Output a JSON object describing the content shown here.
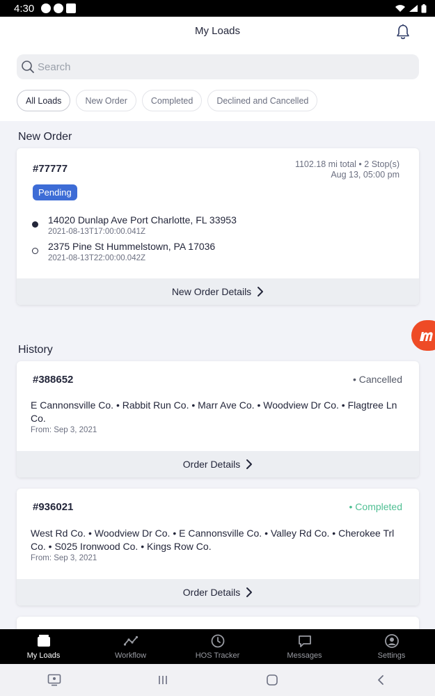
{
  "status_bar": {
    "time": "4:30"
  },
  "header": {
    "title": "My Loads"
  },
  "search": {
    "placeholder": "Search"
  },
  "filters": [
    {
      "label": "All Loads",
      "active": true
    },
    {
      "label": "New Order",
      "active": false
    },
    {
      "label": "Completed",
      "active": false
    },
    {
      "label": "Declined and Cancelled",
      "active": false
    }
  ],
  "new_order": {
    "section_title": "New Order",
    "id": "#77777",
    "distance": "1102.18 mi total • 2 Stop(s)",
    "date": "Aug 13, 05:00 pm",
    "badge": "Pending",
    "stops": [
      {
        "address": "14020 Dunlap Ave Port Charlotte, FL 33953",
        "time": "2021-08-13T17:00:00.041Z"
      },
      {
        "address": "2375 Pine St Hummelstown, PA 17036",
        "time": "2021-08-13T22:00:00.042Z"
      }
    ],
    "details_label": "New Order Details"
  },
  "history": {
    "section_title": "History",
    "orders": [
      {
        "id": "#388652",
        "status": "• Cancelled",
        "stops": "E Cannonsville Co. • Rabbit Run Co. • Marr Ave Co. • Woodview Dr Co. • Flagtree Ln Co.",
        "from": "From: Sep 3, 2021",
        "details_label": "Order Details"
      },
      {
        "id": "#936021",
        "status": "• Completed",
        "stops": "West Rd Co. • Woodview Dr Co. • E Cannonsville Co. • Valley Rd Co. • Cherokee Trl Co. • S025 Ironwood Co. • Kings Row Co.",
        "from": "From: Sep 3, 2021",
        "details_label": "Order Details"
      }
    ]
  },
  "bottom_nav": [
    {
      "label": "My Loads",
      "icon": "truck-icon",
      "active": true
    },
    {
      "label": "Workflow",
      "icon": "workflow-icon",
      "active": false
    },
    {
      "label": "HOS Tracker",
      "icon": "clock-icon",
      "active": false
    },
    {
      "label": "Messages",
      "icon": "chat-icon",
      "active": false
    },
    {
      "label": "Settings",
      "icon": "user-icon",
      "active": false
    }
  ],
  "colors": {
    "accent_blue": "#3d6cd6",
    "completed_green": "#4fbf93",
    "brand_orange": "#ee4b26",
    "text_dark": "#23263a"
  }
}
